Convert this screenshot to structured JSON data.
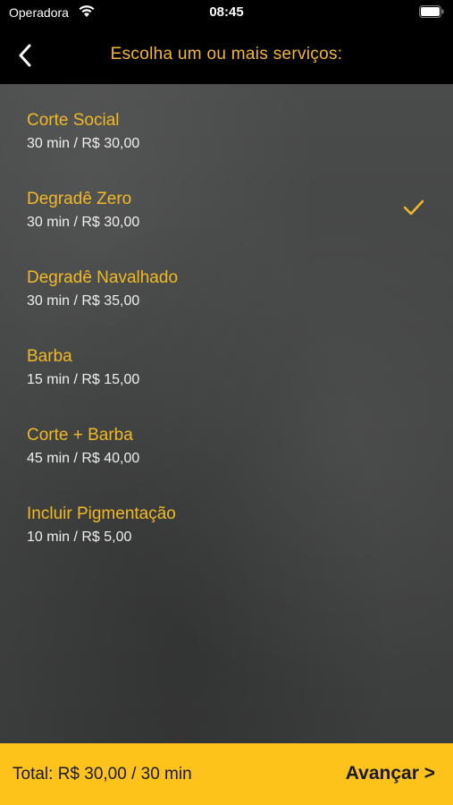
{
  "status_bar": {
    "carrier": "Operadora",
    "time": "08:45"
  },
  "nav": {
    "title": "Escolha um ou mais serviços:"
  },
  "services": [
    {
      "name": "Corte Social",
      "detail": "30 min / R$ 30,00",
      "selected": false
    },
    {
      "name": "Degradê Zero",
      "detail": "30 min / R$ 30,00",
      "selected": true
    },
    {
      "name": "Degradê Navalhado",
      "detail": "30 min / R$ 35,00",
      "selected": false
    },
    {
      "name": "Barba",
      "detail": "15 min / R$ 15,00",
      "selected": false
    },
    {
      "name": "Corte + Barba",
      "detail": "45 min / R$ 40,00",
      "selected": false
    },
    {
      "name": "Incluir Pigmentação",
      "detail": "10 min / R$ 5,00",
      "selected": false
    }
  ],
  "footer": {
    "total": "Total: R$ 30,00 / 30 min",
    "advance_label": "Avançar >"
  },
  "colors": {
    "accent": "#f2b925",
    "footer_bg": "#fec31a"
  }
}
